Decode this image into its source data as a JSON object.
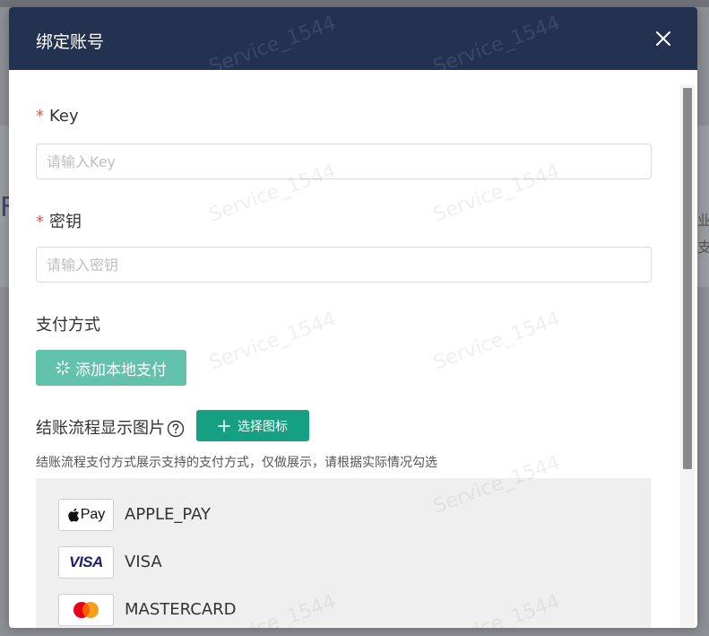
{
  "background": {
    "right_text_1": "业",
    "right_text_2": "支",
    "left_text": "F"
  },
  "watermark": "Service_1544",
  "modal": {
    "title": "绑定账号",
    "close_icon": "close-icon",
    "fields": {
      "key": {
        "required_mark": "*",
        "label": "Key",
        "value": "",
        "placeholder": "请输入Key"
      },
      "secret": {
        "required_mark": "*",
        "label": "密钥",
        "value": "",
        "placeholder": "请输入密钥"
      }
    },
    "payment_method": {
      "label": "支付方式",
      "add_button_label": "添加本地支付",
      "add_button_icon": "loading-spinner-icon"
    },
    "checkout_image": {
      "label": "结账流程显示图片",
      "help_icon": "question-circle-icon",
      "select_button_label": "选择图标",
      "select_button_icon": "plus-icon",
      "hint": "结账流程支付方式展示支持的支付方式，仅做展示，请根据实际情况勾选"
    },
    "payment_items": [
      {
        "name": "APPLE_PAY",
        "logo_text": "Pay",
        "logo_icon": "apple-pay-logo-icon"
      },
      {
        "name": "VISA",
        "logo_text": "VISA",
        "logo_icon": "visa-logo-icon"
      },
      {
        "name": "MASTERCARD",
        "logo_text": "",
        "logo_icon": "mastercard-logo-icon"
      }
    ]
  },
  "colors": {
    "header": "#243252",
    "primary_green": "#16a083",
    "light_green": "#62c2ab",
    "required": "#e2574c",
    "visa_blue": "#1a1f71",
    "mastercard_red": "#eb001b",
    "mastercard_orange": "#f79e1b"
  }
}
